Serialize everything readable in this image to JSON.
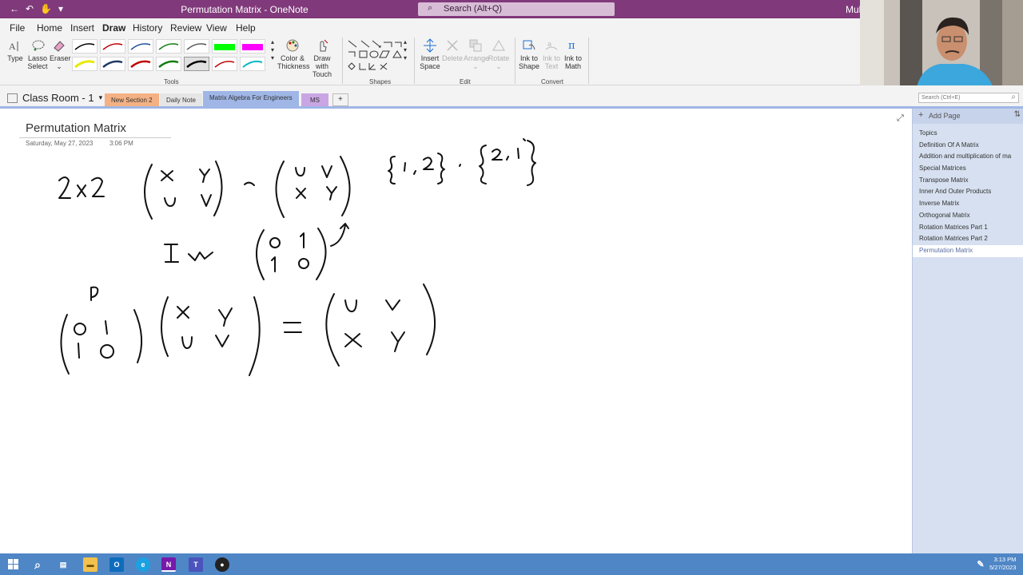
{
  "titlebar": {
    "title": "Permutation Matrix - OneNote",
    "search_placeholder": "Search (Alt+Q)",
    "user": "Mukl"
  },
  "menu": [
    "File",
    "Home",
    "Insert",
    "Draw",
    "History",
    "Review",
    "View",
    "Help"
  ],
  "ribbon": {
    "type": "Type",
    "lasso1": "Lasso",
    "lasso2": "Select",
    "eraser": "Eraser",
    "color1": "Color &",
    "color2": "Thickness",
    "touch1": "Draw with",
    "touch2": "Touch",
    "tools_group": "Tools",
    "shapes_group": "Shapes",
    "insert1": "Insert",
    "insert2": "Space",
    "delete": "Delete",
    "arrange": "Arrange",
    "rotate": "Rotate",
    "edit_group": "Edit",
    "ink_shape1": "Ink to",
    "ink_shape2": "Shape",
    "ink_text1": "Ink to",
    "ink_text2": "Text",
    "ink_math1": "Ink to",
    "ink_math2": "Math",
    "convert_group": "Convert",
    "pen_colors": [
      "#000000",
      "#c00000",
      "#1f4e9c",
      "#107c10",
      "#595959",
      "#00ff00",
      "#ff00ff",
      "#e8e800",
      "#203864",
      "#c00000",
      "#107c10",
      "#000000",
      "#c00000",
      "#00b7c3"
    ]
  },
  "notebook": {
    "name": "Class Room - 1",
    "tabs": [
      {
        "label": "New Section 2",
        "color": "#f4b183"
      },
      {
        "label": "Daily Note",
        "color": "#e6e6e6"
      },
      {
        "label": "Matrix Algebra For Engineers",
        "color": "#9fb6e6"
      },
      {
        "label": "MS",
        "color": "#c9a6e3"
      },
      {
        "label": "+",
        "color": "#f3f3f3"
      }
    ]
  },
  "sidebar": {
    "search_placeholder": "Search (Ctrl+E)",
    "add_page": "Add Page",
    "pages": [
      "Topics",
      "Definition Of  A Matrix",
      "Addition and multiplication of ma",
      "Special Matrices",
      "Transpose Matrix",
      "Inner And Outer Products",
      "Inverse Matrix",
      "Orthogonal Matrix",
      "Rotation Matrices Part 1",
      "Rotation Matrices Part 2",
      "Permutation Matrix"
    ],
    "selected_index": 10
  },
  "page": {
    "title": "Permutation Matrix",
    "date": "Saturday, May 27, 2023",
    "time": "3:06 PM"
  },
  "taskbar": {
    "time": "3:13 PM",
    "date": "5/27/2023"
  }
}
